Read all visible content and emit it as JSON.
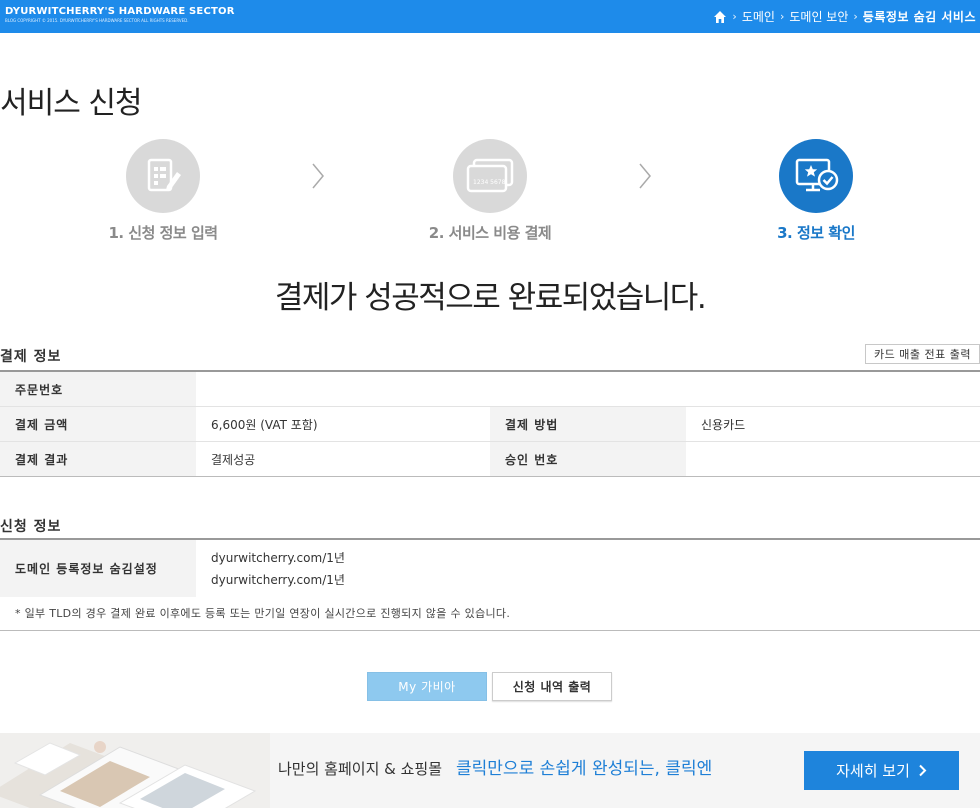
{
  "brand": {
    "title": "DYURWITCHERRY'S HARDWARE SECTOR",
    "subtitle": "BLOG COPYRIGHT © 2015. DYURWITCHERRY'S HARDWARE SECTOR ALL RIGHTS RESERVED."
  },
  "breadcrumb": {
    "icon": "home-icon",
    "items": [
      "도메인",
      "도메인 보안"
    ],
    "current": "등록정보 숨김 서비스"
  },
  "page_title": "서비스 신청",
  "steps": [
    {
      "label": "1. 신청 정보 입력",
      "icon": "document-edit-icon",
      "active": false
    },
    {
      "label": "2. 서비스 비용 결제",
      "icon": "credit-card-icon",
      "active": false,
      "card_text": "1234 5678"
    },
    {
      "label": "3. 정보 확인",
      "icon": "monitor-check-icon",
      "active": true
    }
  ],
  "headline": "결제가 성공적으로 완료되었습니다.",
  "payment": {
    "title": "결제 정보",
    "print_button": "카드 매출 전표 출력",
    "order_no_label": "주문번호",
    "order_no_value": "",
    "amount_label": "결제 금액",
    "amount_value": "6,600원 (VAT 포함)",
    "method_label": "결제 방법",
    "method_value": "신용카드",
    "result_label": "결제 결과",
    "result_value": "결제성공",
    "approval_label": "승인 번호",
    "approval_value": ""
  },
  "application": {
    "title": "신청 정보",
    "service_label": "도메인 등록정보 숨김설정",
    "items": [
      "dyurwitcherry.com/1년",
      "dyurwitcherry.com/1년"
    ],
    "note": "* 일부 TLD의 경우 결제 완료 이후에도 등록 또는 만기일 연장이 실시간으로 진행되지 않을 수 있습니다."
  },
  "buttons": {
    "my_gabia": "My 가비아",
    "print_history": "신청 내역 출력"
  },
  "banner": {
    "text": "나만의 홈페이지 & 쇼핑몰",
    "highlight": "클릭만으로 손쉽게 완성되는, 클릭엔",
    "button": "자세히 보기"
  },
  "colors": {
    "topbar": "#1e8bea",
    "active_step": "#1a78c8",
    "inactive_step": "#d9d9d9",
    "primary_button": "#8ec9ef",
    "banner_button": "#1e84dc"
  }
}
